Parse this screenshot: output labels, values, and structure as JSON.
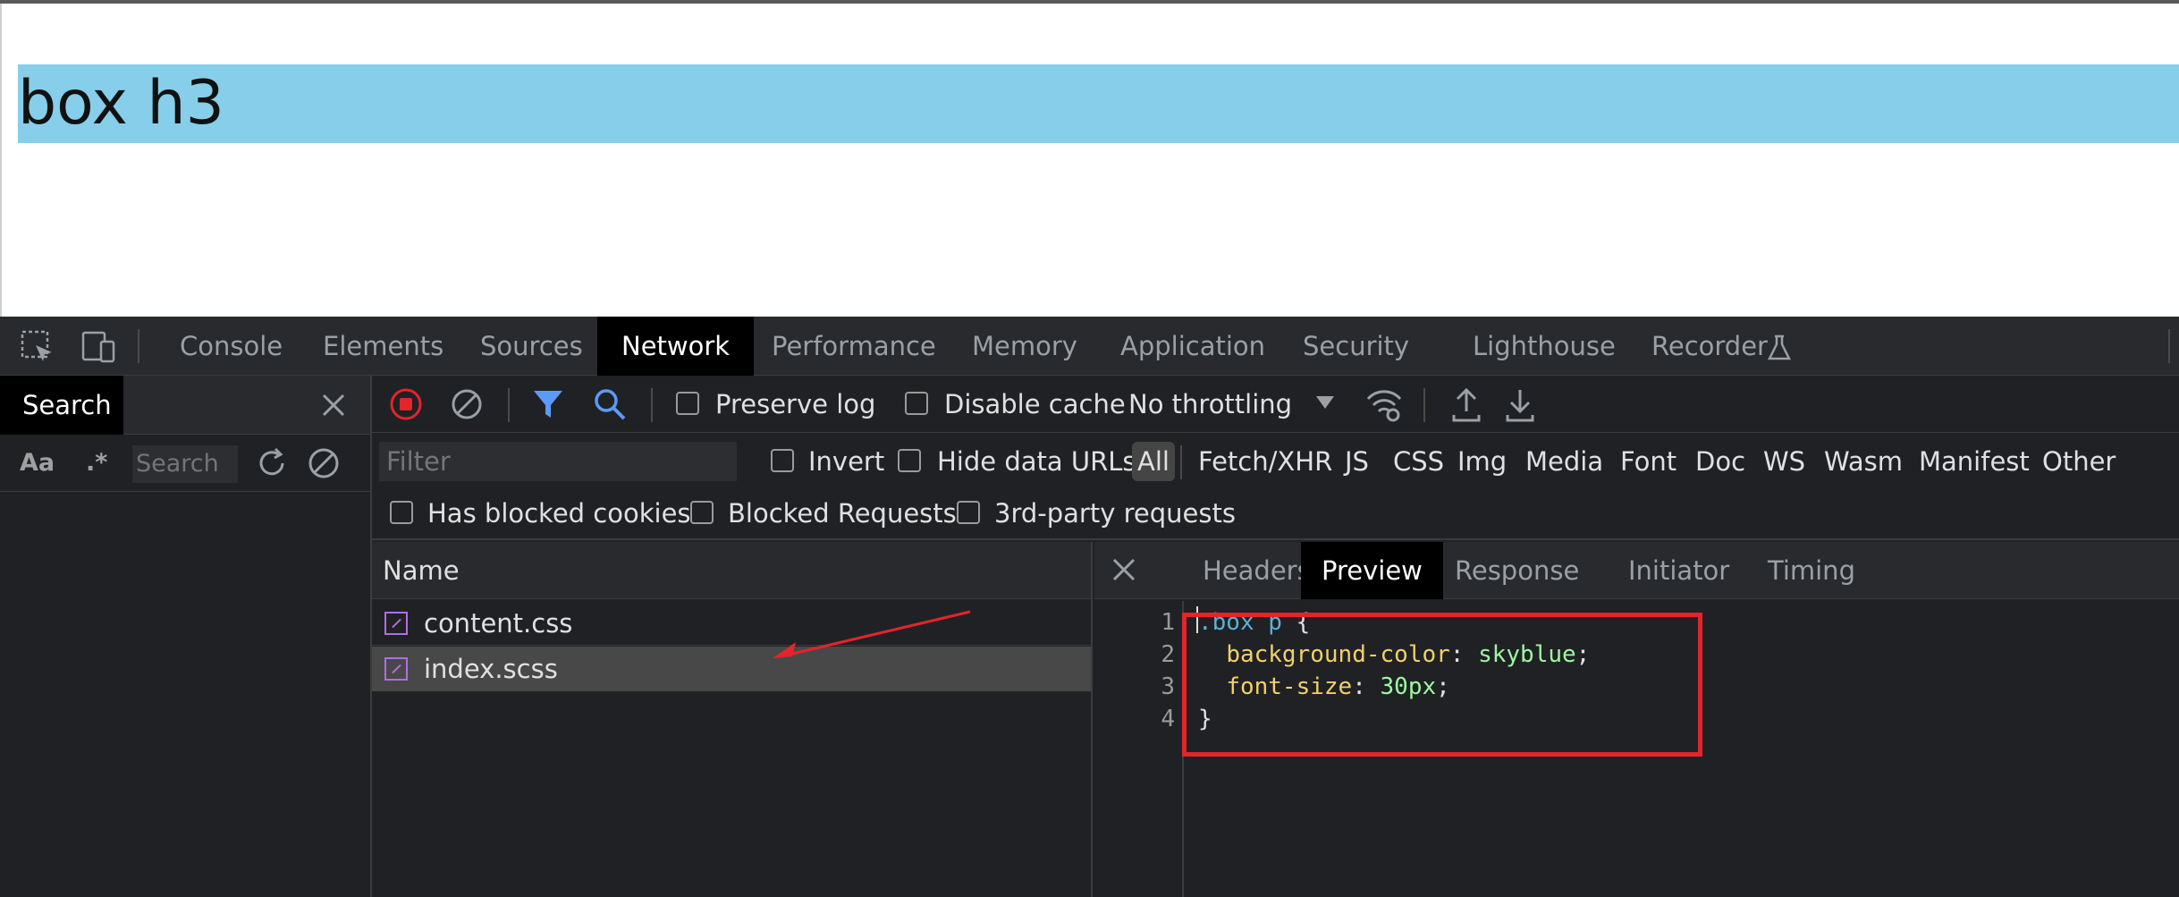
{
  "page": {
    "heading": "box h3"
  },
  "devtools": {
    "tabs": [
      {
        "label": "Console"
      },
      {
        "label": "Elements"
      },
      {
        "label": "Sources"
      },
      {
        "label": "Network"
      },
      {
        "label": "Performance"
      },
      {
        "label": "Memory"
      },
      {
        "label": "Application"
      },
      {
        "label": "Security"
      },
      {
        "label": "Lighthouse"
      },
      {
        "label": "Recorder"
      }
    ],
    "active_tab": "Network",
    "search_drawer": {
      "title": "Search",
      "match_case": "Aa",
      "regex": ".*",
      "placeholder": "Search"
    },
    "network_toolbar": {
      "preserve_log": "Preserve log",
      "disable_cache": "Disable cache",
      "throttling": "No throttling"
    },
    "filter": {
      "placeholder": "Filter",
      "invert": "Invert",
      "hide_data_urls": "Hide data URLs",
      "types": [
        "All",
        "Fetch/XHR",
        "JS",
        "CSS",
        "Img",
        "Media",
        "Font",
        "Doc",
        "WS",
        "Wasm",
        "Manifest",
        "Other"
      ],
      "has_blocked_cookies": "Has blocked cookies",
      "blocked_requests": "Blocked Requests",
      "third_party": "3rd-party requests"
    },
    "request_list": {
      "column": "Name",
      "rows": [
        {
          "name": "content.css"
        },
        {
          "name": "index.scss"
        }
      ]
    },
    "detail": {
      "tabs": [
        "Headers",
        "Preview",
        "Response",
        "Initiator",
        "Timing"
      ],
      "active_tab": "Preview",
      "lines": [
        {
          "num": "1",
          "selector": ".box p",
          "rest": " {"
        },
        {
          "num": "2",
          "prop": "background-color",
          "value": "skyblue"
        },
        {
          "num": "3",
          "prop": "font-size",
          "value": "30px"
        },
        {
          "num": "4",
          "rest": "}"
        }
      ]
    },
    "colors": {
      "highlight": "#87ceeb",
      "annotation": "#e3242b"
    }
  }
}
